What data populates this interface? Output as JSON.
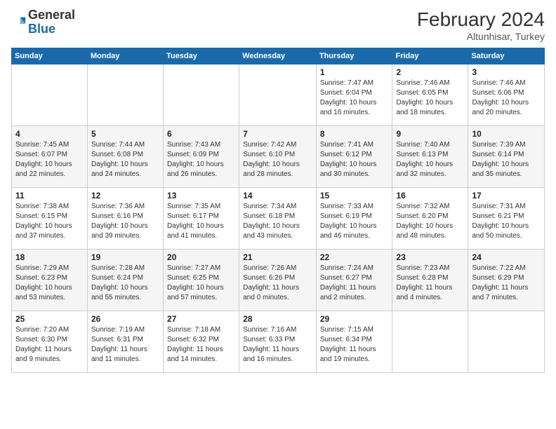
{
  "logo": {
    "general": "General",
    "blue": "Blue"
  },
  "header": {
    "month_year": "February 2024",
    "location": "Altunhisar, Turkey"
  },
  "days_of_week": [
    "Sunday",
    "Monday",
    "Tuesday",
    "Wednesday",
    "Thursday",
    "Friday",
    "Saturday"
  ],
  "weeks": [
    [
      {
        "day": "",
        "info": ""
      },
      {
        "day": "",
        "info": ""
      },
      {
        "day": "",
        "info": ""
      },
      {
        "day": "",
        "info": ""
      },
      {
        "day": "1",
        "info": "Sunrise: 7:47 AM\nSunset: 6:04 PM\nDaylight: 10 hours\nand 16 minutes."
      },
      {
        "day": "2",
        "info": "Sunrise: 7:46 AM\nSunset: 6:05 PM\nDaylight: 10 hours\nand 18 minutes."
      },
      {
        "day": "3",
        "info": "Sunrise: 7:46 AM\nSunset: 6:06 PM\nDaylight: 10 hours\nand 20 minutes."
      }
    ],
    [
      {
        "day": "4",
        "info": "Sunrise: 7:45 AM\nSunset: 6:07 PM\nDaylight: 10 hours\nand 22 minutes."
      },
      {
        "day": "5",
        "info": "Sunrise: 7:44 AM\nSunset: 6:08 PM\nDaylight: 10 hours\nand 24 minutes."
      },
      {
        "day": "6",
        "info": "Sunrise: 7:43 AM\nSunset: 6:09 PM\nDaylight: 10 hours\nand 26 minutes."
      },
      {
        "day": "7",
        "info": "Sunrise: 7:42 AM\nSunset: 6:10 PM\nDaylight: 10 hours\nand 28 minutes."
      },
      {
        "day": "8",
        "info": "Sunrise: 7:41 AM\nSunset: 6:12 PM\nDaylight: 10 hours\nand 30 minutes."
      },
      {
        "day": "9",
        "info": "Sunrise: 7:40 AM\nSunset: 6:13 PM\nDaylight: 10 hours\nand 32 minutes."
      },
      {
        "day": "10",
        "info": "Sunrise: 7:39 AM\nSunset: 6:14 PM\nDaylight: 10 hours\nand 35 minutes."
      }
    ],
    [
      {
        "day": "11",
        "info": "Sunrise: 7:38 AM\nSunset: 6:15 PM\nDaylight: 10 hours\nand 37 minutes."
      },
      {
        "day": "12",
        "info": "Sunrise: 7:36 AM\nSunset: 6:16 PM\nDaylight: 10 hours\nand 39 minutes."
      },
      {
        "day": "13",
        "info": "Sunrise: 7:35 AM\nSunset: 6:17 PM\nDaylight: 10 hours\nand 41 minutes."
      },
      {
        "day": "14",
        "info": "Sunrise: 7:34 AM\nSunset: 6:18 PM\nDaylight: 10 hours\nand 43 minutes."
      },
      {
        "day": "15",
        "info": "Sunrise: 7:33 AM\nSunset: 6:19 PM\nDaylight: 10 hours\nand 46 minutes."
      },
      {
        "day": "16",
        "info": "Sunrise: 7:32 AM\nSunset: 6:20 PM\nDaylight: 10 hours\nand 48 minutes."
      },
      {
        "day": "17",
        "info": "Sunrise: 7:31 AM\nSunset: 6:21 PM\nDaylight: 10 hours\nand 50 minutes."
      }
    ],
    [
      {
        "day": "18",
        "info": "Sunrise: 7:29 AM\nSunset: 6:23 PM\nDaylight: 10 hours\nand 53 minutes."
      },
      {
        "day": "19",
        "info": "Sunrise: 7:28 AM\nSunset: 6:24 PM\nDaylight: 10 hours\nand 55 minutes."
      },
      {
        "day": "20",
        "info": "Sunrise: 7:27 AM\nSunset: 6:25 PM\nDaylight: 10 hours\nand 57 minutes."
      },
      {
        "day": "21",
        "info": "Sunrise: 7:26 AM\nSunset: 6:26 PM\nDaylight: 11 hours\nand 0 minutes."
      },
      {
        "day": "22",
        "info": "Sunrise: 7:24 AM\nSunset: 6:27 PM\nDaylight: 11 hours\nand 2 minutes."
      },
      {
        "day": "23",
        "info": "Sunrise: 7:23 AM\nSunset: 6:28 PM\nDaylight: 11 hours\nand 4 minutes."
      },
      {
        "day": "24",
        "info": "Sunrise: 7:22 AM\nSunset: 6:29 PM\nDaylight: 11 hours\nand 7 minutes."
      }
    ],
    [
      {
        "day": "25",
        "info": "Sunrise: 7:20 AM\nSunset: 6:30 PM\nDaylight: 11 hours\nand 9 minutes."
      },
      {
        "day": "26",
        "info": "Sunrise: 7:19 AM\nSunset: 6:31 PM\nDaylight: 11 hours\nand 11 minutes."
      },
      {
        "day": "27",
        "info": "Sunrise: 7:18 AM\nSunset: 6:32 PM\nDaylight: 11 hours\nand 14 minutes."
      },
      {
        "day": "28",
        "info": "Sunrise: 7:16 AM\nSunset: 6:33 PM\nDaylight: 11 hours\nand 16 minutes."
      },
      {
        "day": "29",
        "info": "Sunrise: 7:15 AM\nSunset: 6:34 PM\nDaylight: 11 hours\nand 19 minutes."
      },
      {
        "day": "",
        "info": ""
      },
      {
        "day": "",
        "info": ""
      }
    ]
  ]
}
